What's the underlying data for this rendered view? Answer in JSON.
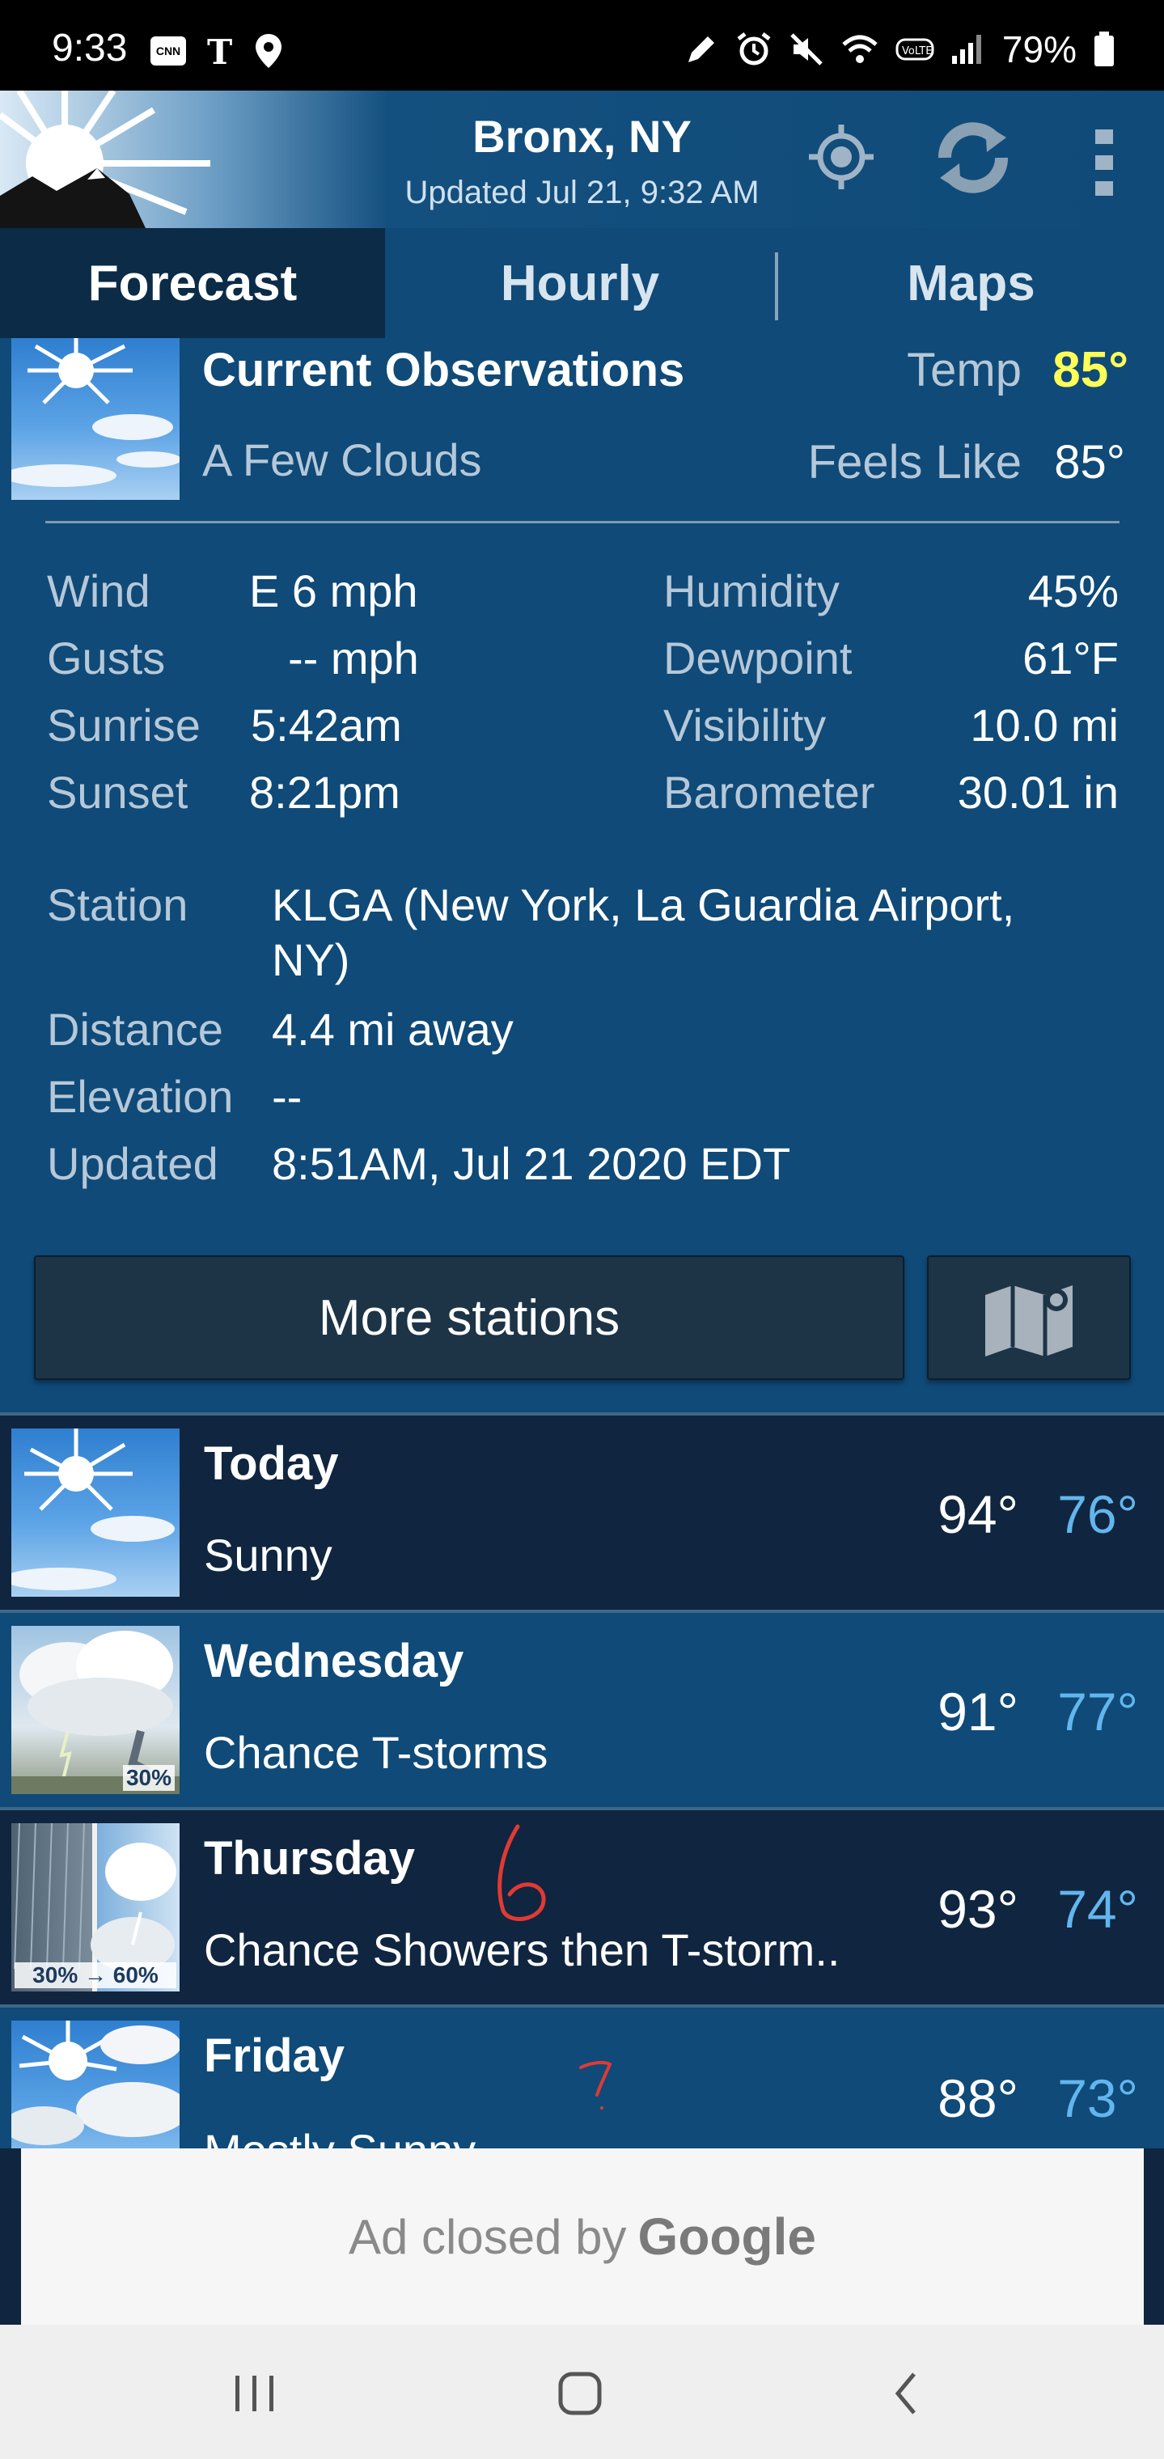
{
  "status_bar": {
    "time": "9:33",
    "battery": "79%",
    "left_icons": [
      "cnn-icon",
      "nyt-icon",
      "location-pin-icon"
    ],
    "right_icons": [
      "pen-icon",
      "alarm-icon",
      "mute-icon",
      "wifi-icon",
      "volte-icon",
      "signal-icon",
      "battery-icon"
    ]
  },
  "header": {
    "location": "Bronx, NY",
    "updated": "Updated Jul 21, 9:32 AM"
  },
  "tabs": [
    {
      "label": "Forecast",
      "active": true
    },
    {
      "label": "Hourly",
      "active": false
    },
    {
      "label": "Maps",
      "active": false
    }
  ],
  "current": {
    "title": "Current Observations",
    "condition": "A Few Clouds",
    "temp_label": "Temp",
    "temp": "85°",
    "feels_label": "Feels Like",
    "feels": "85°",
    "left_stats": [
      {
        "label": "Wind",
        "value": "E 6 mph"
      },
      {
        "label": "Gusts",
        "value": "-- mph"
      },
      {
        "label": "Sunrise",
        "value": "5:42am"
      },
      {
        "label": "Sunset",
        "value": "8:21pm"
      }
    ],
    "right_stats": [
      {
        "label": "Humidity",
        "value": "45%"
      },
      {
        "label": "Dewpoint",
        "value": "61°F"
      },
      {
        "label": "Visibility",
        "value": "10.0 mi"
      },
      {
        "label": "Barometer",
        "value": "30.01 in"
      }
    ],
    "station_label": "Station",
    "station_line1": "KLGA (New York, La Guardia Airport,",
    "station_line2": "NY)",
    "distance_label": "Distance",
    "distance": "4.4 mi away",
    "elevation_label": "Elevation",
    "elevation": "--",
    "updated_label": "Updated",
    "updated": "8:51AM, Jul 21 2020 EDT",
    "more_stations": "More stations"
  },
  "forecast": [
    {
      "day": "Today",
      "condition": "Sunny",
      "hi": "94°",
      "lo": "76°",
      "pop": ""
    },
    {
      "day": "Wednesday",
      "condition": "Chance T-storms",
      "hi": "91°",
      "lo": "77°",
      "pop": "30%"
    },
    {
      "day": "Thursday",
      "condition": "Chance Showers then T-storm..",
      "hi": "93°",
      "lo": "74°",
      "pop": "30% → 60%"
    },
    {
      "day": "Friday",
      "condition": "Mostly Sunny",
      "hi": "88°",
      "lo": "73°",
      "pop": ""
    }
  ],
  "ad": {
    "text": "Ad closed by",
    "brand": "Google"
  },
  "colors": {
    "accent_temp": "#ffff55",
    "low_temp": "#62b6ee",
    "panel": "#0f4a78",
    "dark_row": "#10253f"
  }
}
